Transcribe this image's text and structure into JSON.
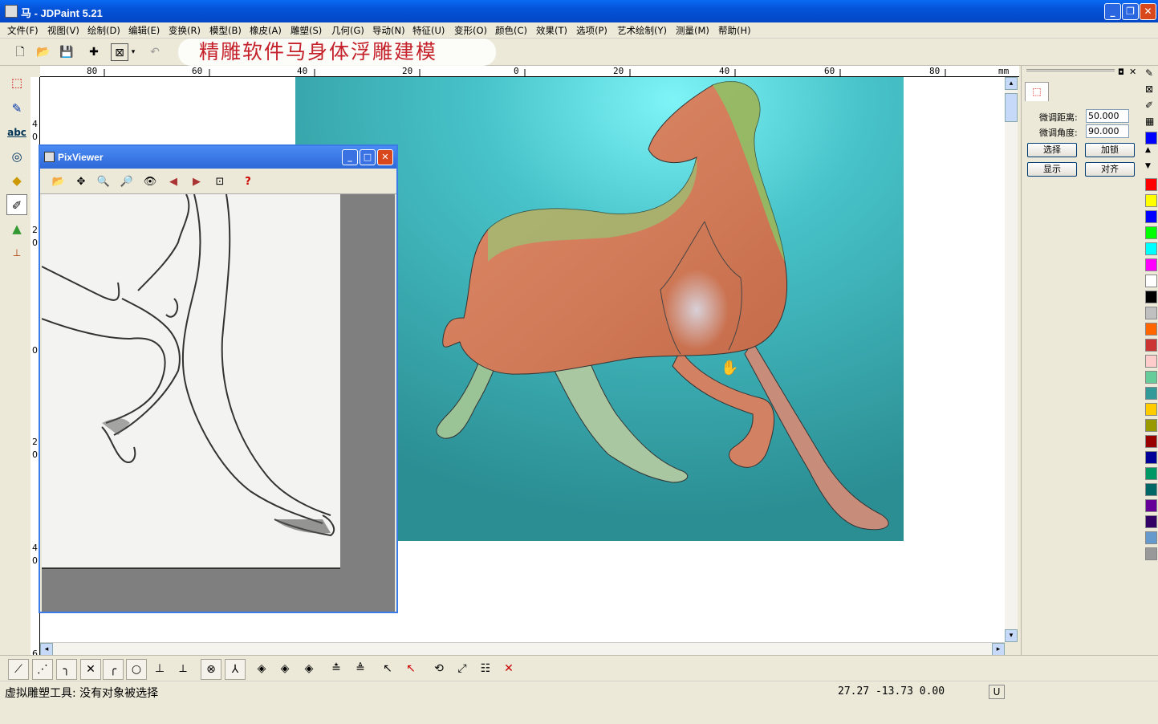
{
  "window": {
    "title": "马 - JDPaint 5.21"
  },
  "menu": [
    "文件(F)",
    "视图(V)",
    "绘制(D)",
    "编辑(E)",
    "变换(R)",
    "模型(B)",
    "橡皮(A)",
    "雕塑(S)",
    "几何(G)",
    "导动(N)",
    "特征(U)",
    "变形(O)",
    "颜色(C)",
    "效果(T)",
    "选项(P)",
    "艺术绘制(Y)",
    "测量(M)",
    "帮助(H)"
  ],
  "caption": "精雕软件马身体浮雕建模",
  "ruler": {
    "unit": "mm",
    "labels": [
      "80",
      "60",
      "40",
      "20",
      "0",
      "20",
      "40",
      "60",
      "80"
    ]
  },
  "ruler_v": {
    "labels": [
      "4",
      "0",
      "2",
      "0",
      "0",
      "2",
      "0",
      "4",
      "0",
      "6"
    ]
  },
  "pixviewer": {
    "title": "PixViewer"
  },
  "right_panel": {
    "distance_label": "微调距离:",
    "distance_value": "50.000",
    "angle_label": "微调角度:",
    "angle_value": "90.000",
    "btn_select": "选择",
    "btn_lock": "加锁",
    "btn_show": "显示",
    "btn_align": "对齐"
  },
  "palette": [
    "#ff0000",
    "#ffff00",
    "#0000ff",
    "#00ff00",
    "#00ffff",
    "#ff00ff",
    "#ffffff",
    "#000000",
    "#c0c0c0",
    "#ff6600",
    "#cc3333",
    "#ffcccc",
    "#66cc99",
    "#339999",
    "#ffcc00",
    "#999900",
    "#990000",
    "#000099",
    "#009966",
    "#006666",
    "#660099",
    "#330066",
    "#6699cc",
    "#999999"
  ],
  "status": {
    "text": "虚拟雕塑工具: 没有对象被选择",
    "coords": "27.27 -13.73 0.00",
    "unit_flag": "U"
  }
}
